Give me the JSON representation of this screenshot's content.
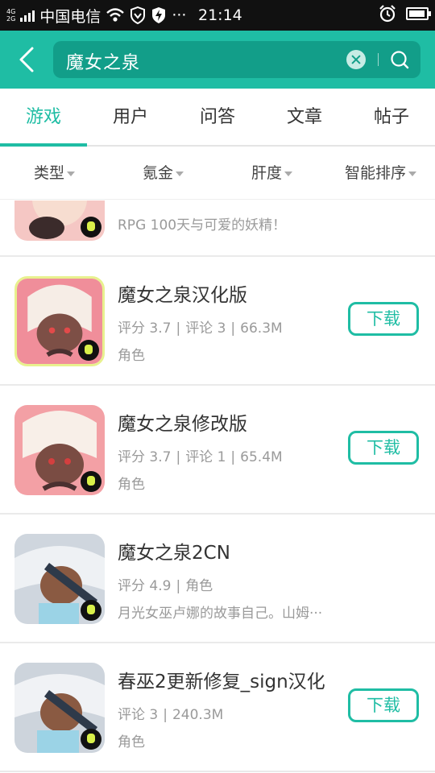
{
  "status_bar": {
    "network": "4G",
    "network2": "2G",
    "carrier": "中国电信",
    "more": "···",
    "time": "21:14",
    "icons": [
      "signal-icon",
      "wifi-icon",
      "shield-icon",
      "flash-icon",
      "alarm-icon",
      "battery-icon"
    ]
  },
  "header": {
    "search_value": "魔女之泉",
    "accent_color": "#1fbda4"
  },
  "tabs": [
    {
      "label": "游戏",
      "active": true
    },
    {
      "label": "用户",
      "active": false
    },
    {
      "label": "问答",
      "active": false
    },
    {
      "label": "文章",
      "active": false
    },
    {
      "label": "帖子",
      "active": false
    }
  ],
  "filters": [
    {
      "label": "类型"
    },
    {
      "label": "氪金"
    },
    {
      "label": "肝度"
    },
    {
      "label": "智能排序"
    }
  ],
  "results": [
    {
      "title": "",
      "line2": "",
      "line3": "RPG 100天与可爱的妖精！",
      "has_download": false
    },
    {
      "title": "魔女之泉汉化版",
      "meta": [
        "评分 3.7",
        "评论 3",
        "66.3M"
      ],
      "line3": "角色",
      "has_download": true,
      "download_label": "下载"
    },
    {
      "title": "魔女之泉修改版",
      "meta": [
        "评分 3.7",
        "评论 1",
        "65.4M"
      ],
      "line3": "角色",
      "has_download": true,
      "download_label": "下载"
    },
    {
      "title": "魔女之泉2CN",
      "meta": [
        "评分 4.9",
        "角色"
      ],
      "line3": "月光女巫卢娜的故事自己。山姆···",
      "has_download": false
    },
    {
      "title": "春巫2更新修复_sign汉化",
      "meta": [
        "评论 3",
        "240.3M"
      ],
      "line3": "角色",
      "has_download": true,
      "download_label": "下载"
    }
  ]
}
